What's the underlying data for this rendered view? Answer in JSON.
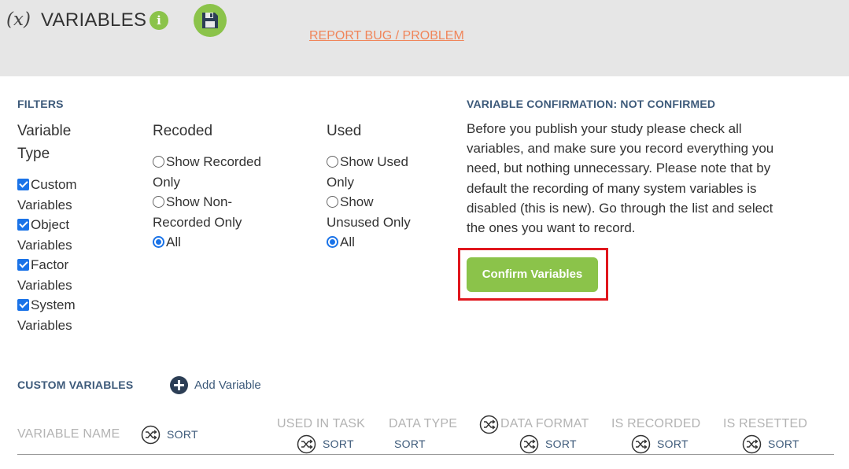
{
  "header": {
    "fx_symbol": "(𝑥)",
    "title": "VARIABLES",
    "info_glyph": "i",
    "report_link": "REPORT BUG / PROBLEM"
  },
  "filters": {
    "label": "FILTERS",
    "variable_type": {
      "heading": [
        "Variable",
        "Type"
      ],
      "options": [
        {
          "lines": [
            "Custom",
            "Variables"
          ],
          "checked": true
        },
        {
          "lines": [
            "Object",
            "Variables"
          ],
          "checked": true
        },
        {
          "lines": [
            "Factor",
            "Variables"
          ],
          "checked": true
        },
        {
          "lines": [
            "System",
            "Variables"
          ],
          "checked": true
        }
      ]
    },
    "recoded": {
      "heading": "Recoded",
      "options": [
        {
          "lines": [
            "Show Recorded",
            "Only"
          ],
          "selected": false
        },
        {
          "lines": [
            "Show Non-",
            "Recorded Only"
          ],
          "selected": false
        },
        {
          "lines": [
            "All"
          ],
          "selected": true
        }
      ]
    },
    "used": {
      "heading": "Used",
      "options": [
        {
          "lines": [
            "Show Used",
            "Only"
          ],
          "selected": false
        },
        {
          "lines": [
            "Show",
            "Unsused Only"
          ],
          "selected": false
        },
        {
          "lines": [
            "All"
          ],
          "selected": true
        }
      ]
    }
  },
  "confirmation": {
    "heading": "VARIABLE CONFIRMATION: NOT CONFIRMED",
    "lines": [
      "Before you publish your study please check all",
      "variables, and make sure you record everything you",
      "need, but nothing unnecessary. Please note that by",
      "default the recording of many system variables is",
      "disabled (this is new). Go through the list and select",
      "the ones you want to record."
    ],
    "button": "Confirm Variables"
  },
  "custom_variables": {
    "heading": "CUSTOM VARIABLES",
    "add_label": "Add Variable",
    "columns": [
      {
        "label": "VARIABLE NAME",
        "sort": "SORT"
      },
      {
        "label": "USED IN TASK",
        "sort": "SORT"
      },
      {
        "label": "DATA TYPE",
        "sort": "SORT"
      },
      {
        "label": "DATA FORMAT",
        "sort": "SORT"
      },
      {
        "label": "IS RECORDED",
        "sort": "SORT"
      },
      {
        "label": "IS RESETTED",
        "sort": "SORT"
      }
    ]
  },
  "colors": {
    "accent_green": "#8bc34a",
    "link_orange": "#f0855a",
    "heading_blue": "#3d5a7a",
    "highlight_red": "#e0161d",
    "checkbox_blue": "#1a73e8"
  }
}
